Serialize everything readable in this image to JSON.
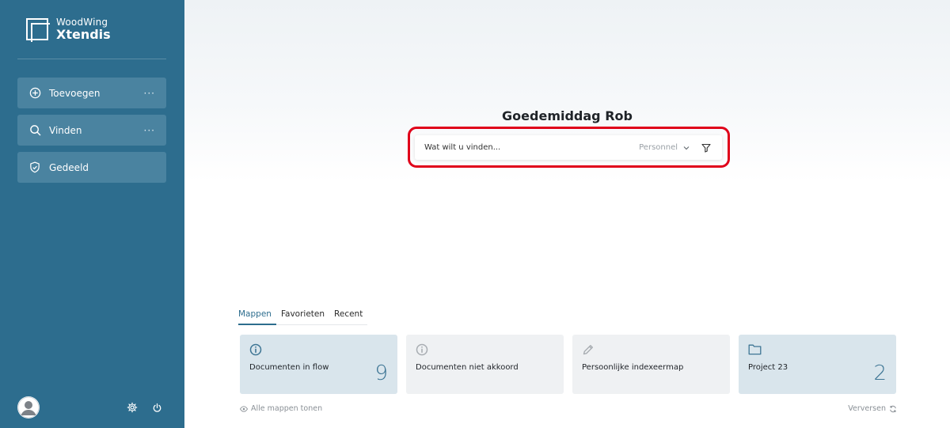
{
  "brand": {
    "top": "WoodWing",
    "bottom": "Xtendis"
  },
  "sidebar": {
    "items": [
      {
        "label": "Toevoegen",
        "icon": "plus-circle-icon",
        "more": "···"
      },
      {
        "label": "Vinden",
        "icon": "search-icon",
        "more": "···"
      },
      {
        "label": "Gedeeld",
        "icon": "shield-icon",
        "more": ""
      }
    ],
    "footer": {
      "avatar": "user-avatar",
      "settings_icon": "gear-icon",
      "power_icon": "power-icon"
    }
  },
  "main": {
    "greeting": "Goedemiddag Rob",
    "search": {
      "placeholder": "Wat wilt u vinden...",
      "scope": "Personnel"
    },
    "tabs": [
      "Mappen",
      "Favorieten",
      "Recent"
    ],
    "cards": [
      {
        "title": "Documenten in flow",
        "count": "9",
        "icon": "info-icon"
      },
      {
        "title": "Documenten niet akkoord",
        "count": "",
        "icon": "info-icon"
      },
      {
        "title": "Persoonlijke indexeermap",
        "count": "",
        "icon": "pencil-icon"
      },
      {
        "title": "Project 23",
        "count": "2",
        "icon": "folder-icon"
      }
    ],
    "show_all": "Alle mappen tonen",
    "refresh": "Verversen"
  },
  "colors": {
    "sidebar": "#2d6d8e",
    "nav_item": "#4a83a0",
    "highlight": "#e0001a",
    "card_blue": "#d9e5ec",
    "card_grey": "#eff1f3"
  }
}
